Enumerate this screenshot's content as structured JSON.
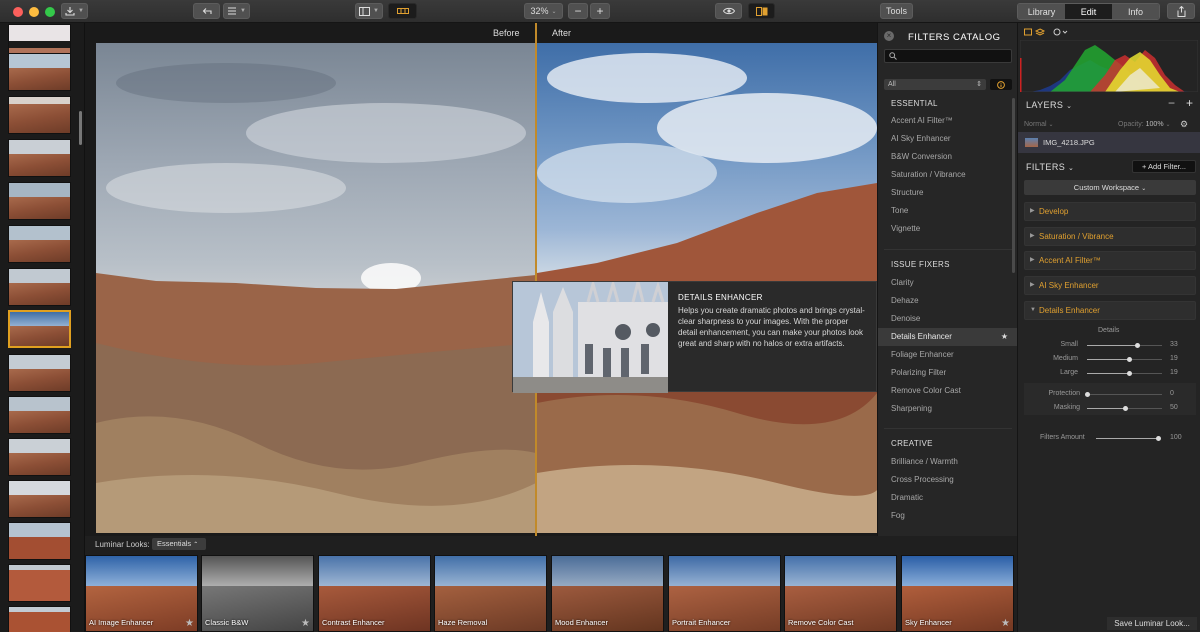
{
  "topbar": {
    "zoom": "32%",
    "tools_label": "Tools",
    "tabs": [
      {
        "label": "Library",
        "active": false
      },
      {
        "label": "Edit",
        "active": true
      },
      {
        "label": "Info",
        "active": false
      }
    ]
  },
  "viewer": {
    "before_label": "Before",
    "after_label": "After"
  },
  "tooltip": {
    "title": "DETAILS ENHANCER",
    "description": "Helps you create dramatic photos and brings crystal-clear sharpness to your images. With the proper detail enhancement, you can make your photos look great and sharp with no halos or extra artifacts."
  },
  "catalog": {
    "title": "FILTERS CATALOG",
    "filter_value": "All",
    "sections": [
      {
        "heading": "ESSENTIAL",
        "items": [
          "Accent AI Filter™",
          "AI Sky Enhancer",
          "B&W Conversion",
          "Saturation / Vibrance",
          "Structure",
          "Tone",
          "Vignette"
        ]
      },
      {
        "heading": "ISSUE FIXERS",
        "items": [
          "Clarity",
          "Dehaze",
          "Denoise",
          "Details Enhancer",
          "Foliage Enhancer",
          "Polarizing Filter",
          "Remove Color Cast",
          "Sharpening"
        ]
      },
      {
        "heading": "CREATIVE",
        "items": [
          "Brilliance / Warmth",
          "Cross Processing",
          "Dramatic",
          "Fog"
        ]
      }
    ],
    "highlighted_item": "Details Enhancer",
    "star": "★"
  },
  "right_panel": {
    "layers_title": "LAYERS",
    "blend_mode": "Normal",
    "opacity_label": "Opacity:",
    "opacity_value": "100%",
    "layer_name": "IMG_4218.JPG",
    "filters_title": "FILTERS",
    "add_filter": "+ Add Filter...",
    "workspace": "Custom Workspace",
    "sections": [
      "Develop",
      "Saturation / Vibrance",
      "Accent AI Filter™",
      "AI Sky Enhancer",
      "Details Enhancer"
    ],
    "details_group_label": "Details",
    "sliders": [
      {
        "label": "Small",
        "value": 33
      },
      {
        "label": "Medium",
        "value": 19
      },
      {
        "label": "Large",
        "value": 19
      },
      {
        "label": "Protection",
        "value": 0
      },
      {
        "label": "Masking",
        "value": 50
      }
    ],
    "filters_amount_label": "Filters Amount",
    "filters_amount_value": 100
  },
  "looks": {
    "label": "Luminar Looks:",
    "category": "Essentials",
    "items": [
      "AI Image Enhancer",
      "Classic B&W",
      "Contrast Enhancer",
      "Haze Removal",
      "Mood Enhancer",
      "Portrait Enhancer",
      "Remove Color Cast",
      "Sky Enhancer"
    ],
    "save_label": "Save Luminar Look..."
  },
  "colors": {
    "accent": "#e0a030",
    "divider": "#c18a2a",
    "selected_thumb": "#e0a020"
  }
}
